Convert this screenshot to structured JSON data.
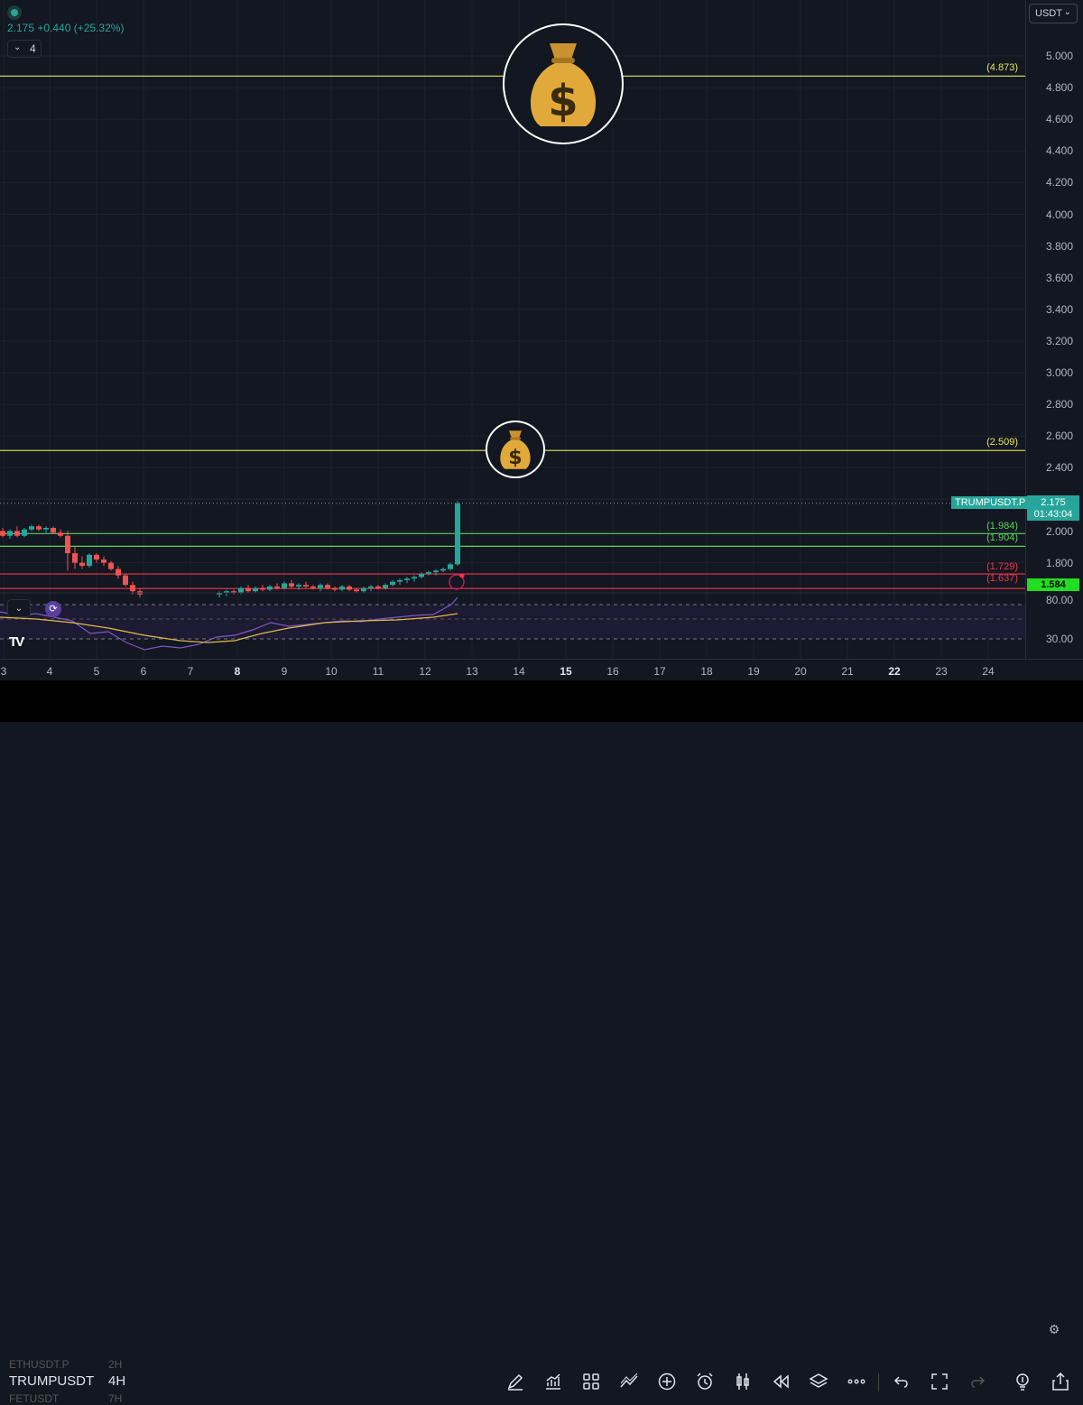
{
  "header": {
    "price_change": "2.175 +0.440 (+25.32%)",
    "collapse_count": "4"
  },
  "currency_selector": "USDT",
  "price_axis": {
    "ticks": [
      "5.000",
      "4.800",
      "4.600",
      "4.400",
      "4.200",
      "4.000",
      "3.800",
      "3.600",
      "3.400",
      "3.200",
      "3.000",
      "2.800",
      "2.600",
      "2.400",
      "2.000",
      "1.800"
    ],
    "rsi_ticks": [
      "80.00",
      "30.00"
    ]
  },
  "levels": [
    {
      "label": "(4.873)",
      "value": 4.873,
      "color": "#e6e65a"
    },
    {
      "label": "(2.509)",
      "value": 2.509,
      "color": "#e6e65a"
    },
    {
      "label": "(1.984)",
      "value": 1.984,
      "color": "#5bd35b"
    },
    {
      "label": "(1.904)",
      "value": 1.904,
      "color": "#5bd35b"
    },
    {
      "label": "(1.729)",
      "value": 1.729,
      "color": "#f23645"
    },
    {
      "label": "(1.637)",
      "value": 1.637,
      "color": "#f23645"
    }
  ],
  "current_price": {
    "symbol_label": "TRUMPUSDT.P",
    "price": "2.175",
    "countdown": "01:43:04",
    "color": "#26a69a"
  },
  "low_price_tag": "1.584",
  "time_axis": {
    "labels": [
      "3",
      "4",
      "5",
      "6",
      "7",
      "8",
      "9",
      "10",
      "11",
      "12",
      "13",
      "14",
      "15",
      "16",
      "17",
      "18",
      "19",
      "20",
      "21",
      "22",
      "23",
      "24"
    ],
    "bold": [
      "8",
      "15",
      "22"
    ]
  },
  "bottom_bar": {
    "symbol": "TRUMPUSDT",
    "interval": "4H",
    "ghost_symbol_above": "ETHUSDT.P",
    "ghost_interval_above": "2H",
    "ghost_symbol_below": "FETUSDT",
    "ghost_interval_below": "7H"
  },
  "toolbar_icons": [
    "pen-icon",
    "chart-indicators-icon",
    "grid-icon",
    "trend-line-icon",
    "add-icon",
    "alarm-icon",
    "candle-type-icon",
    "replay-icon",
    "layers-icon",
    "more-icon",
    "undo-icon",
    "fullscreen-icon",
    "redo-icon",
    "idea-icon",
    "share-icon"
  ],
  "emoji": {
    "money_bag": "💰"
  }
}
